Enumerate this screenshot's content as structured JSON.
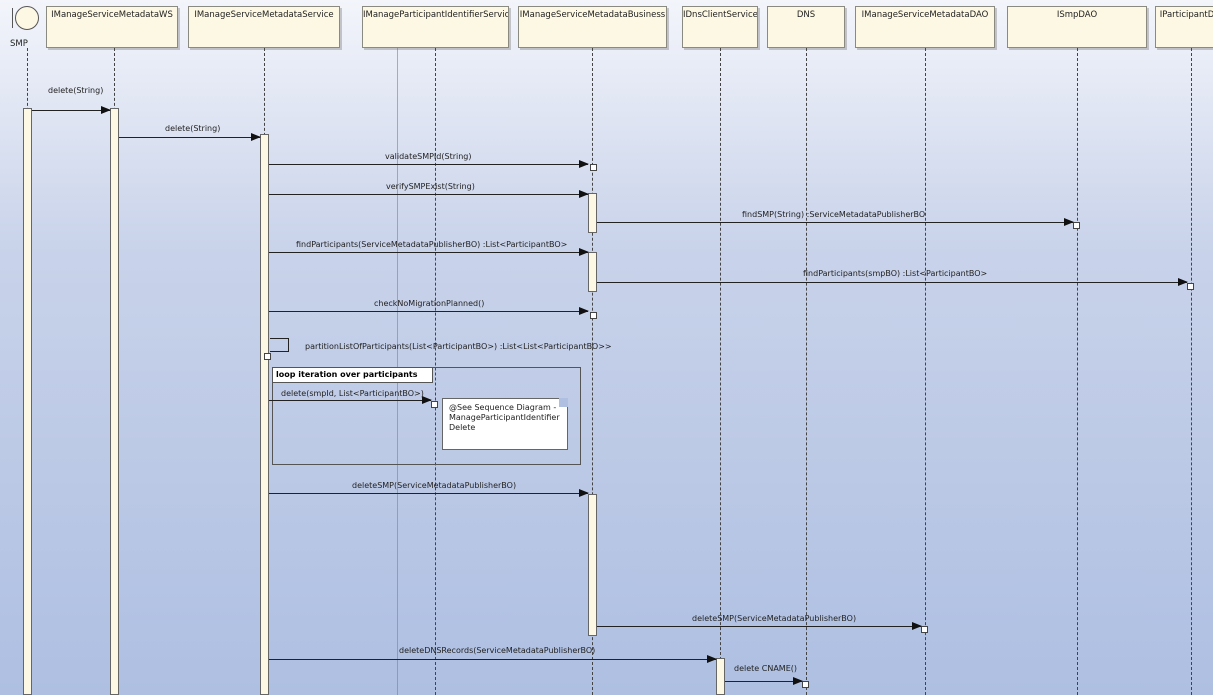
{
  "actor": {
    "name": "SMP"
  },
  "lifelines": [
    "IManageServiceMetadataWS",
    "IManageServiceMetadataService",
    "IManageParticipantIdentifierService",
    "IManageServiceMetadataBusiness",
    "IDnsClientService",
    "DNS",
    "IManageServiceMetadataDAO",
    "ISmpDAO",
    "IParticipantD"
  ],
  "messages": [
    "delete(String)",
    "delete(String)",
    "validateSMPId(String)",
    "verifySMPExist(String)",
    "findSMP(String) :ServiceMetadataPublisherBO",
    "findParticipants(ServiceMetadataPublisherBO) :List<ParticipantBO>",
    "findParticipants(smpBO) :List<ParticipantBO>",
    "checkNoMigrationPlanned()",
    "partitionListOfParticipants(List<ParticipantBO>) :List<List<ParticipantBO>>",
    "delete(smpId, List<ParticipantBO>)",
    "deleteSMP(ServiceMetadataPublisherBO)",
    "deleteSMP(ServiceMetadataPublisherBO)",
    "deleteDNSRecords(ServiceMetadataPublisherBO)",
    "delete CNAME()"
  ],
  "fragment": {
    "label": "loop iteration over participants"
  },
  "note": {
    "lines": [
      "@See Sequence Diagram -",
      "ManageParticipantIdentifier",
      "Delete"
    ]
  }
}
